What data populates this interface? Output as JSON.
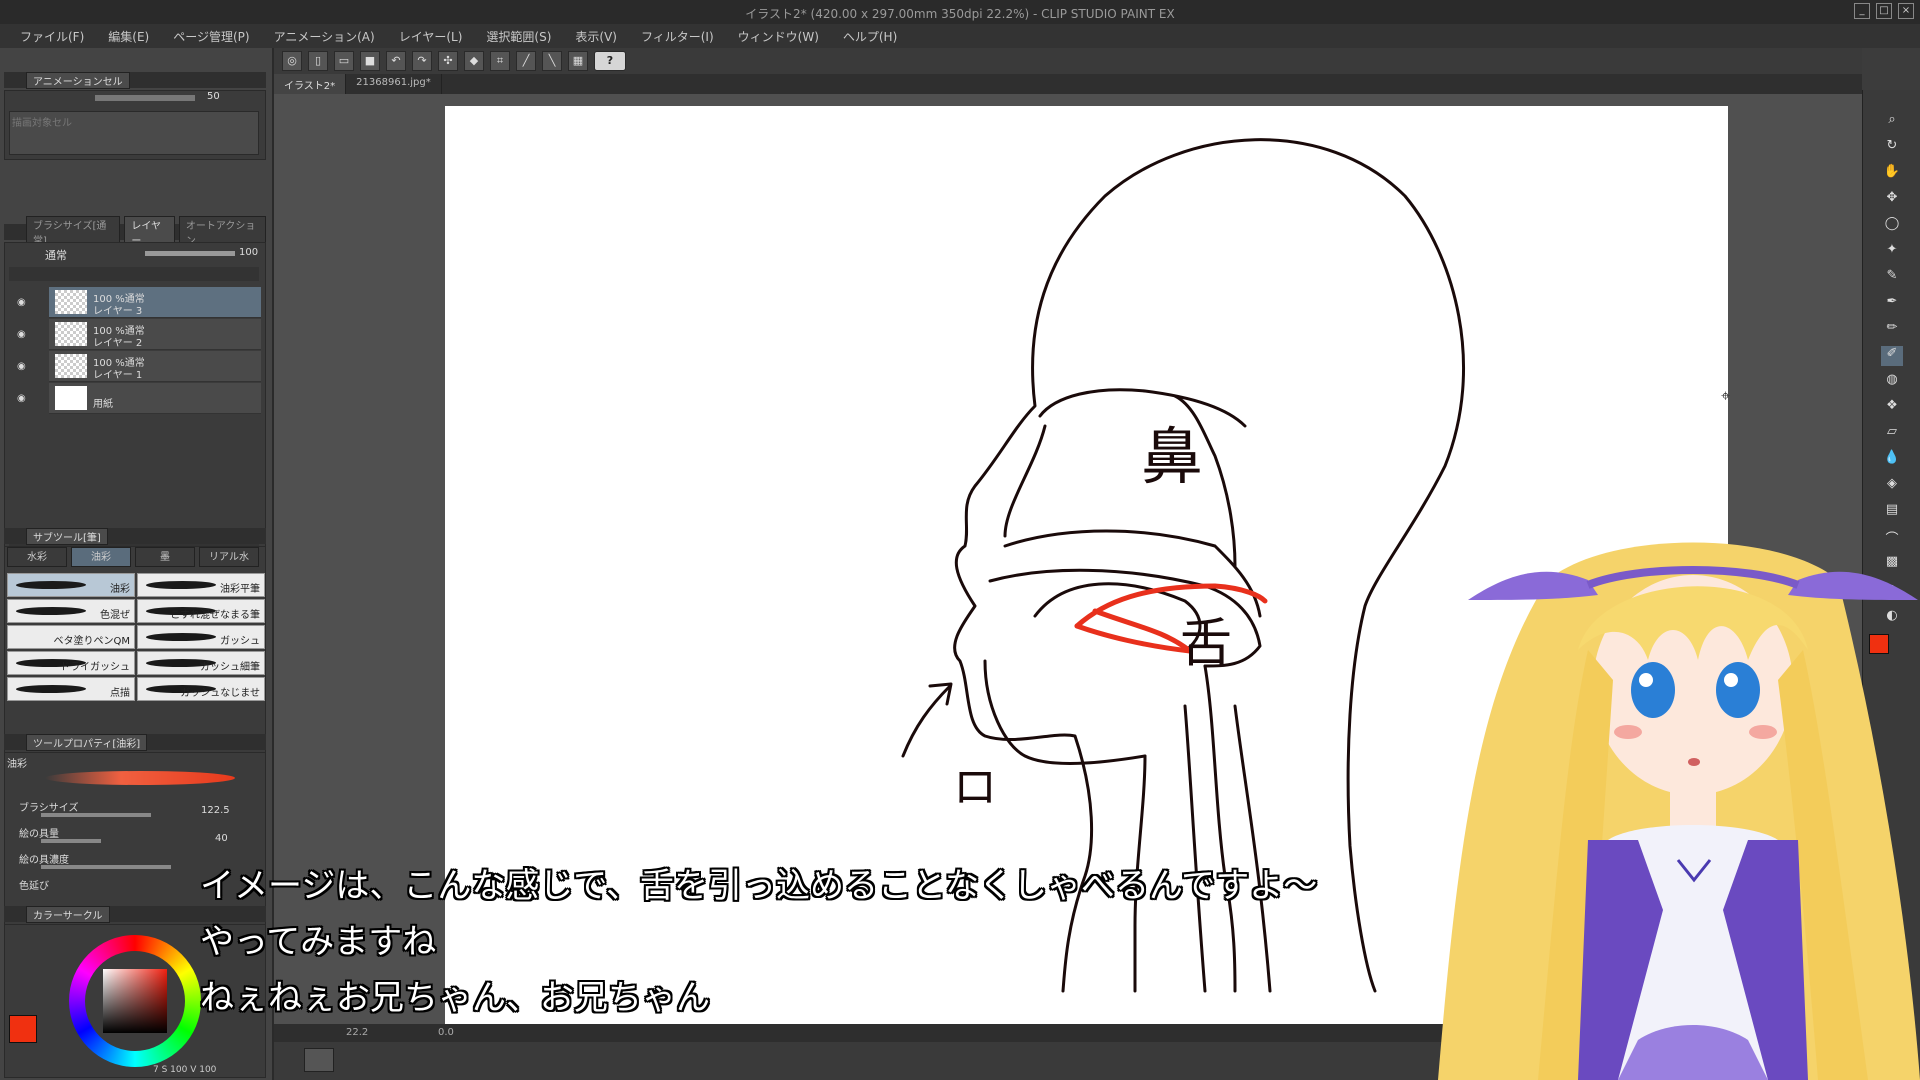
{
  "window": {
    "title": "イラスト2* (420.00 x 297.00mm 350dpi 22.2%) - CLIP STUDIO PAINT EX"
  },
  "menu": [
    "ファイル(F)",
    "編集(E)",
    "ページ管理(P)",
    "アニメーション(A)",
    "レイヤー(L)",
    "選択範囲(S)",
    "表示(V)",
    "フィルター(I)",
    "ウィンドウ(W)",
    "ヘルプ(H)"
  ],
  "doc_tabs": [
    "イラスト2*",
    "21368961.jpg*"
  ],
  "left": {
    "anim_tab": "アニメーションセル",
    "anim_value": "50",
    "anim_placeholder": "描画対象セル",
    "layer_tabs": [
      "ブラシサイズ[通常]",
      "レイヤー",
      "オートアクション"
    ],
    "blend_mode": "通常",
    "opacity": "100",
    "layers": [
      {
        "pct": "100 %通常",
        "name": "レイヤー 3",
        "selected": true
      },
      {
        "pct": "100 %通常",
        "name": "レイヤー 2",
        "selected": false
      },
      {
        "pct": "100 %通常",
        "name": "レイヤー 1",
        "selected": false
      },
      {
        "pct": "",
        "name": "用紙",
        "selected": false
      }
    ],
    "subtool_tab": "サブツール[筆]",
    "brush_tabs": [
      "水彩",
      "油彩",
      "墨",
      "リアル水"
    ],
    "brushes": [
      {
        "name": "油彩",
        "selected": true
      },
      {
        "name": "油彩平筆",
        "selected": false
      },
      {
        "name": "色混ぜ",
        "selected": false
      },
      {
        "name": "こすれ混ぜなまる筆",
        "selected": false
      },
      {
        "name": "ベタ塗りペンQM",
        "selected": false
      },
      {
        "name": "ガッシュ",
        "selected": false
      },
      {
        "name": "ドライガッシュ",
        "selected": false
      },
      {
        "name": "ガッシュ細筆",
        "selected": false
      },
      {
        "name": "点描",
        "selected": false
      },
      {
        "name": "ガッシュなじませ",
        "selected": false
      }
    ],
    "toolprop_tab": "ツールプロパティ[油彩]",
    "toolprop_name": "油彩",
    "props": [
      {
        "label": "ブラシサイズ",
        "value": "122.5"
      },
      {
        "label": "絵の具量",
        "value": "40"
      },
      {
        "label": "絵の具濃度",
        "value": ""
      },
      {
        "label": "色延び",
        "value": ""
      }
    ],
    "color_tab": "カラーサークル",
    "color_values": "7 S 100 V 100",
    "main_color": "#f03010",
    "sub_color": "#5ab8c8"
  },
  "status": {
    "zoom": "22.2",
    "rotate": "0.0"
  },
  "canvas_labels": {
    "nose": "鼻",
    "tongue": "舌",
    "mouth": "ロ"
  },
  "subtitles": [
    "イメージは、こんな感じで、舌を引っ込めることなくしゃべるんですよ〜",
    "やってみますね",
    "ねぇねぇお兄ちゃん、お兄ちゃん"
  ]
}
